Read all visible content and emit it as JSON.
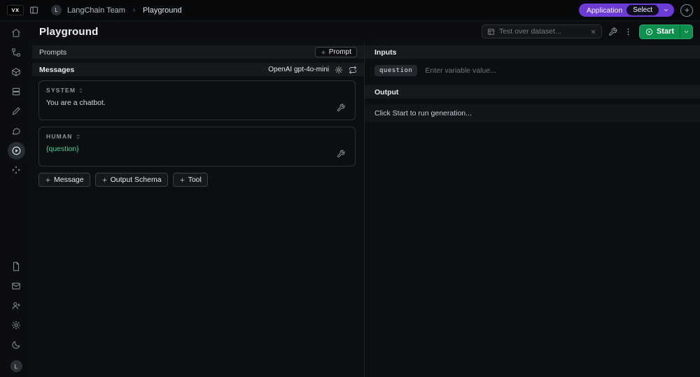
{
  "topbar": {
    "logo_text": "VX",
    "breadcrumb_team": "LangChain Team",
    "breadcrumb_page": "Playground",
    "avatar_initial": "L",
    "application_label": "Application",
    "select_label": "Select"
  },
  "header": {
    "title": "Playground",
    "dataset_placeholder": "Test over dataset...",
    "start_label": "Start"
  },
  "left_panel": {
    "prompts_header": "Prompts",
    "add_prompt_label": "Prompt",
    "messages_header": "Messages",
    "model_label": "OpenAI gpt-4o-mini",
    "messages": [
      {
        "role": "SYSTEM",
        "content": "You are a chatbot."
      },
      {
        "role": "HUMAN",
        "content": "{question}"
      }
    ],
    "add_message_label": "Message",
    "add_output_schema_label": "Output Schema",
    "add_tool_label": "Tool"
  },
  "right_panel": {
    "inputs_header": "Inputs",
    "variable_name": "question",
    "variable_placeholder": "Enter variable value...",
    "output_header": "Output",
    "output_message": "Click Start to run generation..."
  },
  "sidebar": {
    "avatar_initial": "L"
  },
  "colors": {
    "accent_green": "#0f8f4d",
    "accent_purple": "#6d3bd6",
    "variable_green": "#57c89d"
  }
}
